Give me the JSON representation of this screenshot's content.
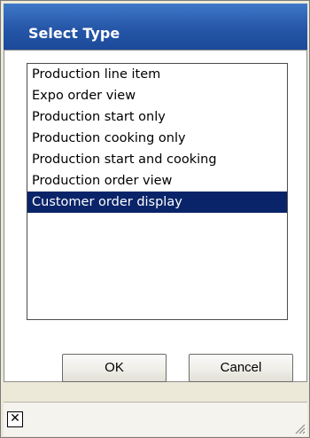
{
  "dialog": {
    "title": "Select Type"
  },
  "list": {
    "items": [
      "Production line item",
      "Expo order view",
      "Production start only",
      "Production cooking only",
      "Production start and cooking",
      "Production order view",
      "Customer order display"
    ],
    "selected_index": 6
  },
  "buttons": {
    "ok_label": "OK",
    "cancel_label": "Cancel"
  },
  "status_bar": {
    "close_glyph": "✕",
    "close_icon": "close-icon",
    "grip_icon": "resize-grip-icon"
  },
  "colors": {
    "title_bar": "#2656a8",
    "selection": "#0a246a"
  }
}
